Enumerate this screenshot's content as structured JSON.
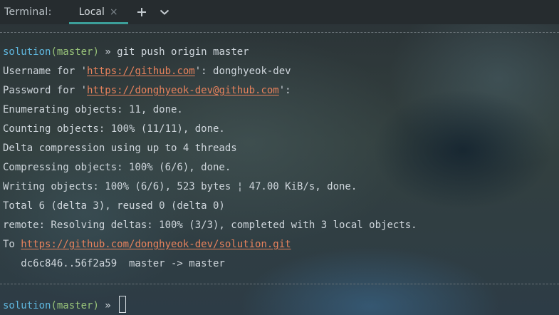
{
  "panel": {
    "title": "Terminal:",
    "tab_label": "Local",
    "close_glyph": "×"
  },
  "colors": {
    "directory": "#5fb6dd",
    "branch": "#98c379",
    "link": "#e8825c",
    "active_tab_underline": "#3c9f9a"
  },
  "toolbar": {
    "add_icon": "plus-icon",
    "menu_icon": "chevron-down-icon"
  },
  "prompt": {
    "dir": "solution",
    "branch": "(master)",
    "arrow": " » "
  },
  "command": "git push origin master",
  "output": {
    "username_prefix": "Username for '",
    "username_url": "https://github.com",
    "username_suffix": "': donghyeok-dev",
    "password_prefix": "Password for '",
    "password_url": "https://donghyeok-dev@github.com",
    "password_suffix": "':",
    "lines": [
      "Enumerating objects: 11, done.",
      "Counting objects: 100% (11/11), done.",
      "Delta compression using up to 4 threads",
      "Compressing objects: 100% (6/6), done.",
      "Writing objects: 100% (6/6), 523 bytes ¦ 47.00 KiB/s, done.",
      "Total 6 (delta 3), reused 0 (delta 0)",
      "remote: Resolving deltas: 100% (3/3), completed with 3 local objects."
    ],
    "to_prefix": "To ",
    "to_url": "https://github.com/donghyeok-dev/solution.git",
    "ref_update": "   dc6c846..56f2a59  master -> master"
  }
}
